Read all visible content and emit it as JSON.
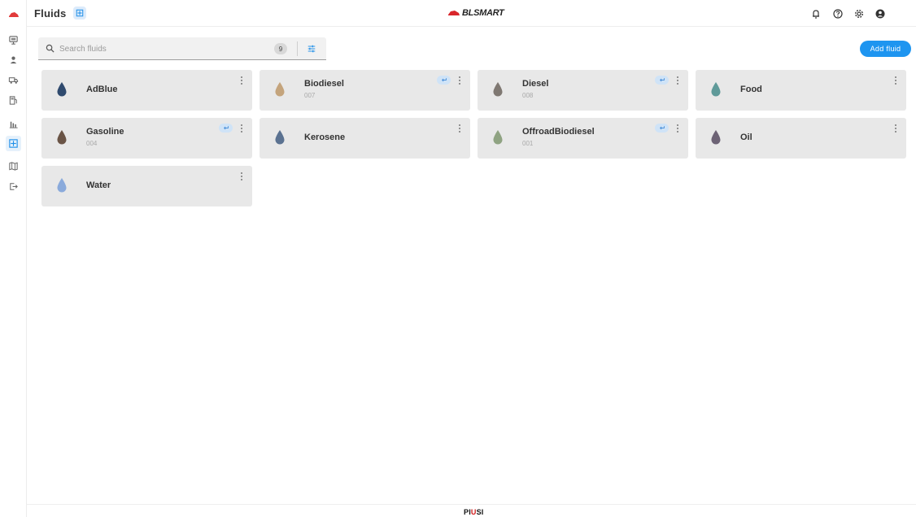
{
  "header": {
    "title": "Fluids",
    "brand": "BLSMART",
    "icons": [
      "bell-icon",
      "help-icon",
      "settings-icon",
      "account-icon"
    ]
  },
  "sidebar": {
    "items": [
      {
        "name": "dashboard",
        "icon": "monitor-icon",
        "active": false
      },
      {
        "name": "users",
        "icon": "person-icon",
        "active": false
      },
      {
        "name": "vehicles",
        "icon": "truck-icon",
        "active": false
      },
      {
        "name": "stations",
        "icon": "fuel-station-icon",
        "active": false
      },
      {
        "name": "reports",
        "icon": "bar-chart-icon",
        "active": false
      },
      {
        "name": "fluids",
        "icon": "fluid-grid-icon",
        "active": true
      },
      {
        "name": "map",
        "icon": "map-icon",
        "active": false
      },
      {
        "name": "logout",
        "icon": "logout-icon",
        "active": false
      }
    ]
  },
  "search": {
    "placeholder": "Search fluids",
    "value": "",
    "count": "9"
  },
  "toolbar": {
    "add_label": "Add fluid"
  },
  "colors": {
    "accent": "#1e95f0",
    "card_bg": "#e8e8e8",
    "sync_badge": "#cfe3f7"
  },
  "fluids": [
    {
      "name": "AdBlue",
      "code": "",
      "color": "#2f4a6e",
      "synced": false
    },
    {
      "name": "Biodiesel",
      "code": "007",
      "color": "#c4a47c",
      "synced": true
    },
    {
      "name": "Diesel",
      "code": "008",
      "color": "#7f7872",
      "synced": true
    },
    {
      "name": "Food",
      "code": "",
      "color": "#5f9a99",
      "synced": false
    },
    {
      "name": "Gasoline",
      "code": "004",
      "color": "#6a5446",
      "synced": true
    },
    {
      "name": "Kerosene",
      "code": "",
      "color": "#5b7291",
      "synced": false
    },
    {
      "name": "OffroadBiodiesel",
      "code": "001",
      "color": "#8fa382",
      "synced": true
    },
    {
      "name": "Oil",
      "code": "",
      "color": "#6d6375",
      "synced": false
    },
    {
      "name": "Water",
      "code": "",
      "color": "#8aaadb",
      "synced": false
    }
  ],
  "footer": {
    "logo_a": "PI",
    "logo_b": "U",
    "logo_c": "SI"
  }
}
